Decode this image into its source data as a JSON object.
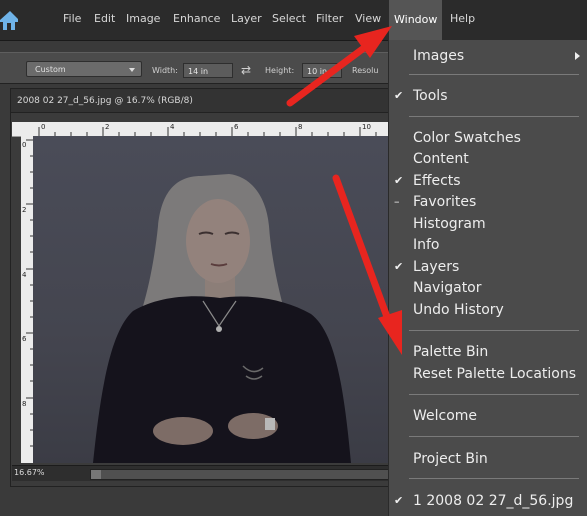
{
  "menubar": {
    "items": [
      {
        "label": "File",
        "name": "menu-file"
      },
      {
        "label": "Edit",
        "name": "menu-edit"
      },
      {
        "label": "Image",
        "name": "menu-image"
      },
      {
        "label": "Enhance",
        "name": "menu-enhance"
      },
      {
        "label": "Layer",
        "name": "menu-layer"
      },
      {
        "label": "Select",
        "name": "menu-select"
      },
      {
        "label": "Filter",
        "name": "menu-filter"
      },
      {
        "label": "View",
        "name": "menu-view"
      },
      {
        "label": "Window",
        "name": "menu-window"
      },
      {
        "label": "Help",
        "name": "menu-help"
      }
    ]
  },
  "options_bar": {
    "preset": "Custom",
    "width_label": "Width:",
    "width_value": "14 in",
    "height_label": "Height:",
    "height_value": "10 in",
    "resolution_label": "Resolu"
  },
  "document": {
    "title": "2008 02 27_d_56.jpg @ 16.7% (RGB/8)",
    "zoom": "16.67%",
    "ruler_top": [
      "0",
      "2",
      "4",
      "6",
      "8",
      "10"
    ],
    "ruler_left": [
      "0",
      "2",
      "4",
      "6",
      "8"
    ]
  },
  "window_menu": {
    "images": "Images",
    "tools": "Tools",
    "color_swatches": "Color Swatches",
    "content": "Content",
    "effects": "Effects",
    "favorites": "Favorites",
    "histogram": "Histogram",
    "info": "Info",
    "layers": "Layers",
    "navigator": "Navigator",
    "undo_history": "Undo History",
    "palette_bin": "Palette Bin",
    "reset_palette_locations": "Reset Palette Locations",
    "welcome": "Welcome",
    "project_bin": "Project Bin",
    "recent_file": "1 2008 02 27_d_56.jpg",
    "check_mark": "✔",
    "dash_mark": "–"
  },
  "colors": {
    "annotation_arrow": "#e8251f",
    "menu_bg": "#4b4b4b",
    "highlight": "#5d5d5d"
  }
}
